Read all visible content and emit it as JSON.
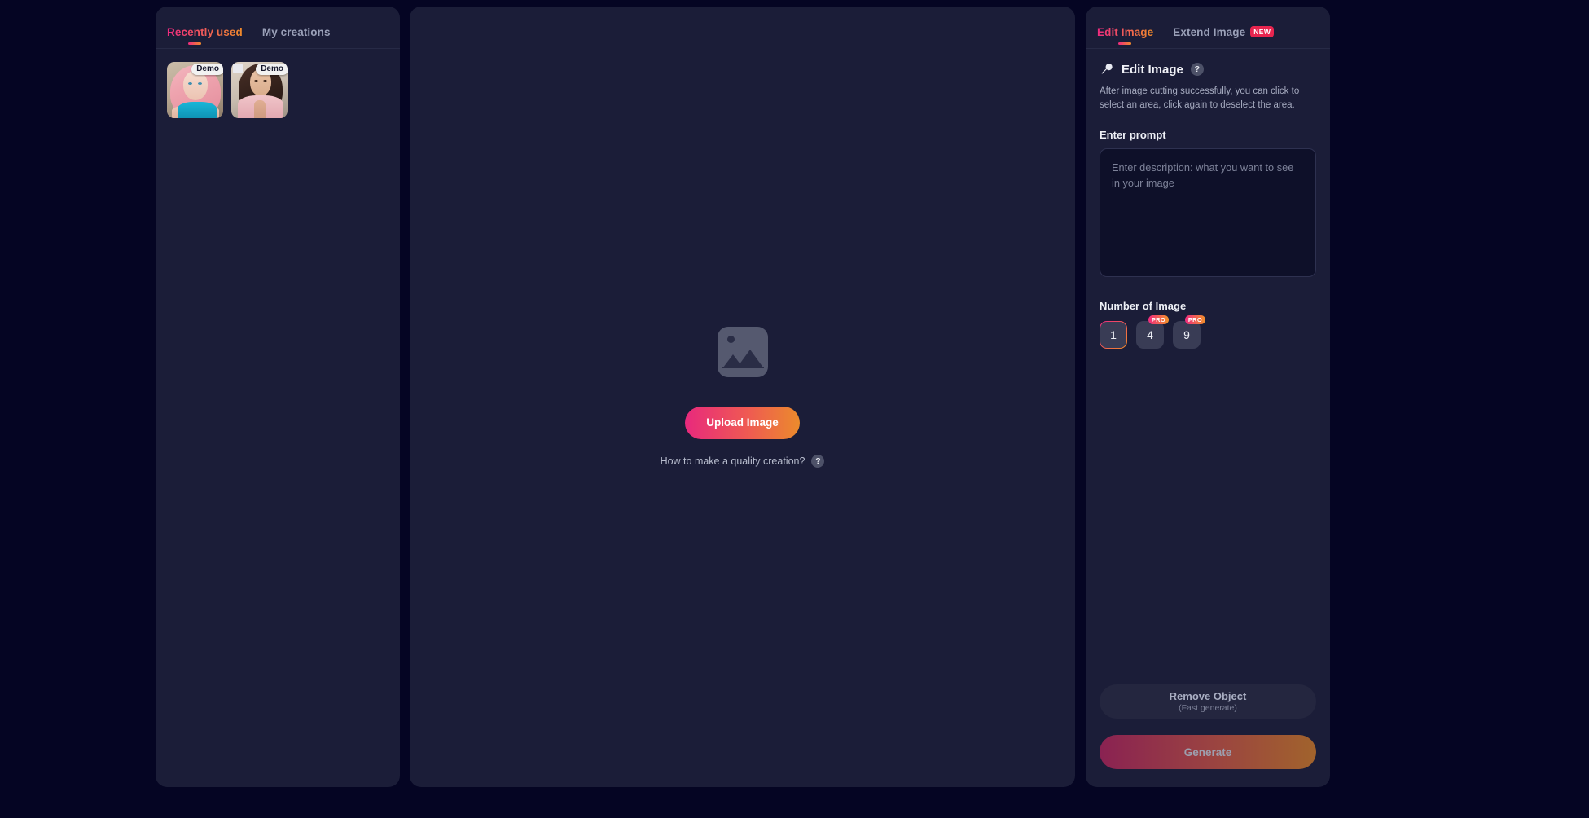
{
  "colors": {
    "page_bg": "#050523",
    "panel_bg": "#1b1d38",
    "accent_start": "#ef2a7f",
    "accent_end": "#f08b2a",
    "new_badge": "#e8254f",
    "input_bg": "#0e1029"
  },
  "left_panel": {
    "tabs": [
      {
        "label": "Recently used",
        "active": true
      },
      {
        "label": "My creations",
        "active": false
      }
    ],
    "thumbnails": [
      {
        "tag": "Demo"
      },
      {
        "tag": "Demo"
      }
    ]
  },
  "center_panel": {
    "placeholder_icon": "image-placeholder-icon",
    "upload_label": "Upload Image",
    "howto_text": "How to make a quality creation?",
    "howto_help_icon": "question-mark-icon"
  },
  "right_panel": {
    "tabs": [
      {
        "label": "Edit Image",
        "active": true,
        "badge": ""
      },
      {
        "label": "Extend Image",
        "active": false,
        "badge": "NEW"
      }
    ],
    "section": {
      "icon": "magic-wand-icon",
      "title": "Edit Image",
      "help_icon": "question-mark-icon",
      "hint": "After image cutting successfully, you can click to select an area, click again to deselect the area."
    },
    "prompt": {
      "label": "Enter prompt",
      "placeholder": "Enter description: what you want to see in your image",
      "value": ""
    },
    "number_of_image": {
      "label": "Number of Image",
      "options": [
        {
          "value": "1",
          "selected": true,
          "badge": ""
        },
        {
          "value": "4",
          "selected": false,
          "badge": "PRO"
        },
        {
          "value": "9",
          "selected": false,
          "badge": "PRO"
        }
      ]
    },
    "footer": {
      "remove_label": "Remove Object",
      "remove_sub": "(Fast generate)",
      "generate_label": "Generate"
    }
  }
}
